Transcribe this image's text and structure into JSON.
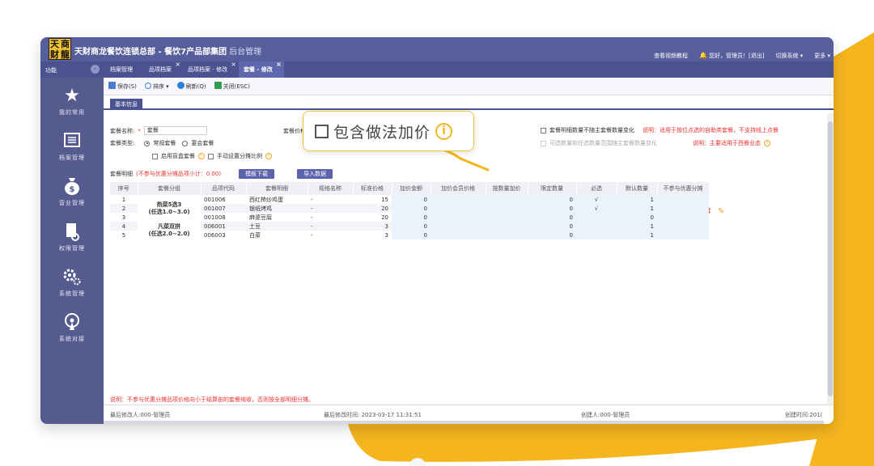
{
  "app": {
    "logo_chars": [
      "天",
      "商",
      "财",
      "龍"
    ],
    "title": "天财商龙餐饮连锁总部 - 餐饮7产品部集团",
    "title_suffix": "后台管理",
    "top_links": [
      "查看视频教程",
      "您好，管理员！[退出]",
      "切换系统 ▾",
      "更多 ▾"
    ]
  },
  "tabbar": {
    "func_label": "功能",
    "tabs": [
      {
        "label": "档案管理",
        "closable": false,
        "active": false
      },
      {
        "label": "品项档案",
        "closable": true,
        "active": false
      },
      {
        "label": "品项档案 - 修改",
        "closable": true,
        "active": false
      },
      {
        "label": "套餐 - 修改",
        "closable": true,
        "active": true
      }
    ]
  },
  "sidebar": {
    "items": [
      {
        "label": "我的常用",
        "icon": "star-icon"
      },
      {
        "label": "档案管理",
        "icon": "archive-icon"
      },
      {
        "label": "营业管理",
        "icon": "money-bag-icon"
      },
      {
        "label": "权限管理",
        "icon": "permission-icon"
      },
      {
        "label": "系统管理",
        "icon": "gears-icon"
      },
      {
        "label": "系统对接",
        "icon": "broadcast-icon"
      }
    ]
  },
  "toolbar": {
    "save": "保存(S)",
    "sort": "排序",
    "refresh": "刷新(Q)",
    "close": "关闭(ESC)"
  },
  "subtab": "基本信息",
  "form": {
    "name_label": "套餐名称:",
    "name_value": "套餐",
    "price_label": "套餐价格:",
    "price_value": "0",
    "type_label": "套餐类型:",
    "type_regular": "常规套餐",
    "type_banquet": "宴会套餐",
    "enable_blind": "启用盲盒套餐",
    "manual_ratio": "手动设置分摊比例",
    "detail_qty_label": "套餐明细数量不随主套餐数量变化",
    "detail_qty_note": "说明：适用于按位点选的自助类套餐，不支持线上点餐",
    "grayed_label": "可选数量和任选数量范围随主套餐数量变化",
    "grayed_note": "说明：主要适用于西餐业态",
    "detail_label": "套餐明细",
    "detail_hint": "(不参与优惠分摊品项小计：0.00)",
    "template_btn": "模板下载",
    "import_btn": "导入数据"
  },
  "callout": {
    "text": "包含做法加价"
  },
  "table": {
    "headers": [
      "序号",
      "套餐分组",
      "品项代码",
      "套餐明细",
      "规格名称",
      "标准价格",
      "加价金额",
      "加价会员价格",
      "按数量加价",
      "限定数量",
      "必选",
      "默认数量",
      "不参与优惠分摊"
    ],
    "groups": [
      {
        "name": "热菜5选3",
        "range": "(任选1.0~3.0)"
      },
      {
        "name": "凡菜双拼",
        "range": "(任选2.0~2.0)"
      }
    ],
    "rows": [
      {
        "seq": "1",
        "code": "001006",
        "item": "西红柿炒鸡蛋",
        "spec": "-",
        "price": "15",
        "add": "0",
        "limit": "0",
        "required": "√",
        "default": "1"
      },
      {
        "seq": "2",
        "code": "001007",
        "item": "银纸烤鸡",
        "spec": "-",
        "price": "20",
        "add": "0",
        "limit": "0",
        "required": "√",
        "default": "1"
      },
      {
        "seq": "3",
        "code": "001008",
        "item": "麻婆豆腐",
        "spec": "-",
        "price": "20",
        "add": "0",
        "limit": "0",
        "required": "",
        "default": "0"
      },
      {
        "seq": "4",
        "code": "006001",
        "item": "土豆",
        "spec": "-",
        "price": "3",
        "add": "0",
        "limit": "0",
        "required": "",
        "default": "1"
      },
      {
        "seq": "5",
        "code": "006003",
        "item": "白菜",
        "spec": "-",
        "price": "3",
        "add": "0",
        "limit": "0",
        "required": "",
        "default": "1"
      }
    ]
  },
  "footer_note": "说明：不参与优惠分摊品项价格向小于结算剖的套餐纯收，否则按全部明细分摊。",
  "status": {
    "modifier": "最后修改人:000-管理员",
    "modified_time": "最后修改时间: 2023-03-17 11:31:51",
    "creator": "创建人:000-管理员",
    "created_time": "创建时间:201("
  },
  "colors": {
    "titlebar": "#565e9c",
    "sidebar": "#555b8e",
    "accent_yellow": "#f5b51f",
    "accent_red": "#e33333"
  }
}
